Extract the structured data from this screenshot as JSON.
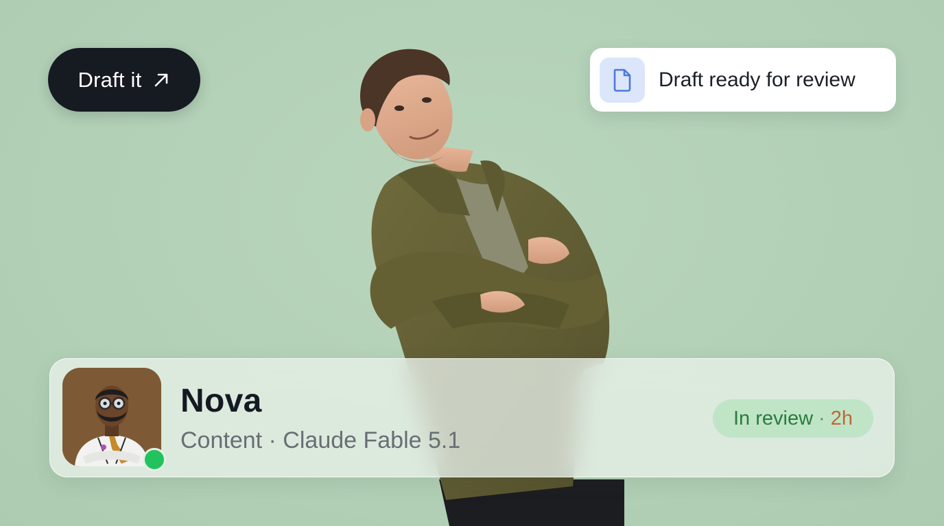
{
  "draft_button": {
    "label": "Draft it",
    "icon": "arrow-up-right-icon"
  },
  "notification": {
    "icon": "document-icon",
    "text": "Draft ready for review"
  },
  "agent_card": {
    "name": "Nova",
    "subtitle": "Content · Claude Fable 5.1",
    "online": true,
    "status": {
      "state": "In review",
      "separator": "·",
      "time": "2h"
    }
  },
  "colors": {
    "background": "#b4d2b8",
    "button_dark": "#161a21",
    "doc_tile": "#dbe6fb",
    "status_bg": "#bfe5c6",
    "status_text": "#2c7a3f",
    "time_text": "#c0653a",
    "online": "#22c35e"
  }
}
